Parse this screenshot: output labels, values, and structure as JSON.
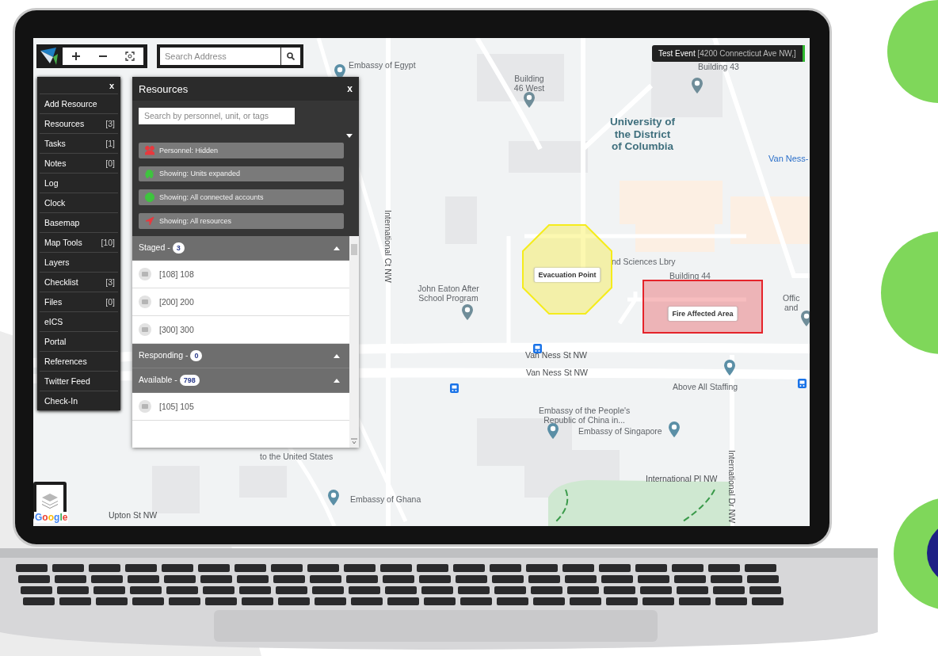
{
  "toolbar": {
    "search": {
      "placeholder": "Search Address"
    }
  },
  "event": {
    "name": "Test Event",
    "address": "[4200 Connecticut Ave NW,]"
  },
  "menu": {
    "close": "x",
    "items": [
      {
        "label": "Add Resource"
      },
      {
        "label": "Resources",
        "count": "[3]"
      },
      {
        "label": "Tasks",
        "count": "[1]"
      },
      {
        "label": "Notes",
        "count": "[0]"
      },
      {
        "label": "Log"
      },
      {
        "label": "Clock"
      },
      {
        "label": "Basemap"
      },
      {
        "label": "Map Tools",
        "count": "[10]"
      },
      {
        "label": "Layers"
      },
      {
        "label": "Checklist",
        "count": "[3]"
      },
      {
        "label": "Files",
        "count": "[0]"
      },
      {
        "label": "eICS"
      },
      {
        "label": "Portal"
      },
      {
        "label": "References"
      },
      {
        "label": "Twitter Feed"
      },
      {
        "label": "Check-In"
      }
    ]
  },
  "resources_panel": {
    "title": "Resources",
    "close": "x",
    "search": {
      "placeholder": "Search by personnel, unit, or tags"
    },
    "filters": [
      {
        "label": "Personnel: Hidden",
        "kind": "personnel",
        "color": "#e8383d"
      },
      {
        "label": "Showing: Units expanded",
        "kind": "vehicle",
        "color": "#3ec43e"
      },
      {
        "label": "Showing: All connected accounts",
        "kind": "account",
        "color": "#3ec43e"
      },
      {
        "label": "Showing: All resources",
        "kind": "arrow",
        "color": "#e8383d"
      }
    ],
    "groups": [
      {
        "label": "Staged -",
        "count": "3",
        "expanded": true,
        "units": [
          "[108] 108",
          "[200] 200",
          "[300] 300"
        ]
      },
      {
        "label": "Responding -",
        "count": "0",
        "expanded": true
      },
      {
        "label": "Available -",
        "count": "798",
        "expanded": true,
        "units": [
          "[105] 105"
        ]
      }
    ]
  },
  "map": {
    "labels": [
      {
        "text": "Embassy of Egypt",
        "kind": "poi"
      },
      {
        "text": "Building\n46 West",
        "kind": "poi"
      },
      {
        "text": "Building 43",
        "kind": "poi"
      },
      {
        "text": "University of\nthe District\nof Columbia",
        "kind": "campus"
      },
      {
        "text": "Van Ness-",
        "kind": "transit"
      },
      {
        "text": "International Ct NW",
        "kind": "street-vertical"
      },
      {
        "text": "John Eaton After\nSchool Program",
        "kind": "poi"
      },
      {
        "text": "nd Sciences Lbry",
        "kind": "poi"
      },
      {
        "text": "Building 44",
        "kind": "poi"
      },
      {
        "text": "Offic\nand",
        "kind": "poi"
      },
      {
        "text": "Van Ness St NW",
        "kind": "street"
      },
      {
        "text": "Van Ness St NW",
        "kind": "street"
      },
      {
        "text": "Above All Staffing",
        "kind": "poi"
      },
      {
        "text": "Embassy of the People's\nRepublic of China in...",
        "kind": "poi"
      },
      {
        "text": "Embassy of Singapore",
        "kind": "poi"
      },
      {
        "text": "International Pl NW",
        "kind": "street"
      },
      {
        "text": "International Dr NW",
        "kind": "street-vertical"
      },
      {
        "text": "Embassy of Ghana",
        "kind": "poi"
      },
      {
        "text": "to the United States",
        "kind": "poi"
      },
      {
        "text": "Upton St NW",
        "kind": "street"
      }
    ],
    "zones": [
      {
        "label": "Evacuation Point",
        "kind": "octagon",
        "color": "#f5ec1c"
      },
      {
        "label": "Fire Affected Area",
        "kind": "rectangle",
        "color": "#e5232a"
      }
    ],
    "attribution": "Google"
  }
}
